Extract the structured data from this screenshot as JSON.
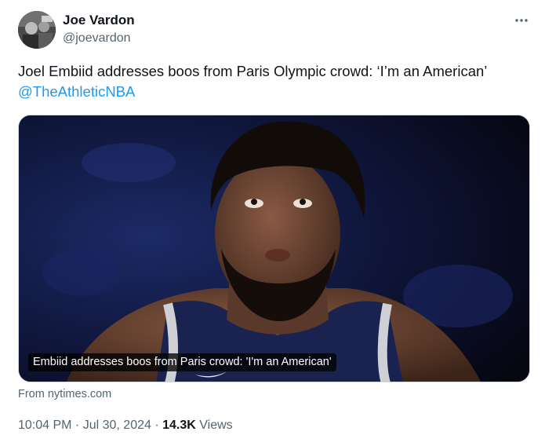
{
  "author": {
    "display_name": "Joe Vardon",
    "handle": "@joevardon"
  },
  "tweet": {
    "text_line1": "Joel Embiid addresses boos from Paris Olympic crowd: ‘I’m an American’",
    "mention": "@TheAthleticNBA"
  },
  "card": {
    "caption": "Embiid addresses boos from Paris crowd: 'I'm an American'",
    "source": "From nytimes.com"
  },
  "meta": {
    "time": "10:04 PM",
    "separator1": " · ",
    "date": "Jul 30, 2024",
    "separator2": " · ",
    "views_count": "14.3K",
    "views_label": " Views"
  },
  "icons": {
    "more": "more-horizontal-icon",
    "avatar": "profile-photo"
  },
  "colors": {
    "link": "#1d9bf0",
    "secondary_text": "#536471",
    "primary_text": "#0f1419"
  }
}
